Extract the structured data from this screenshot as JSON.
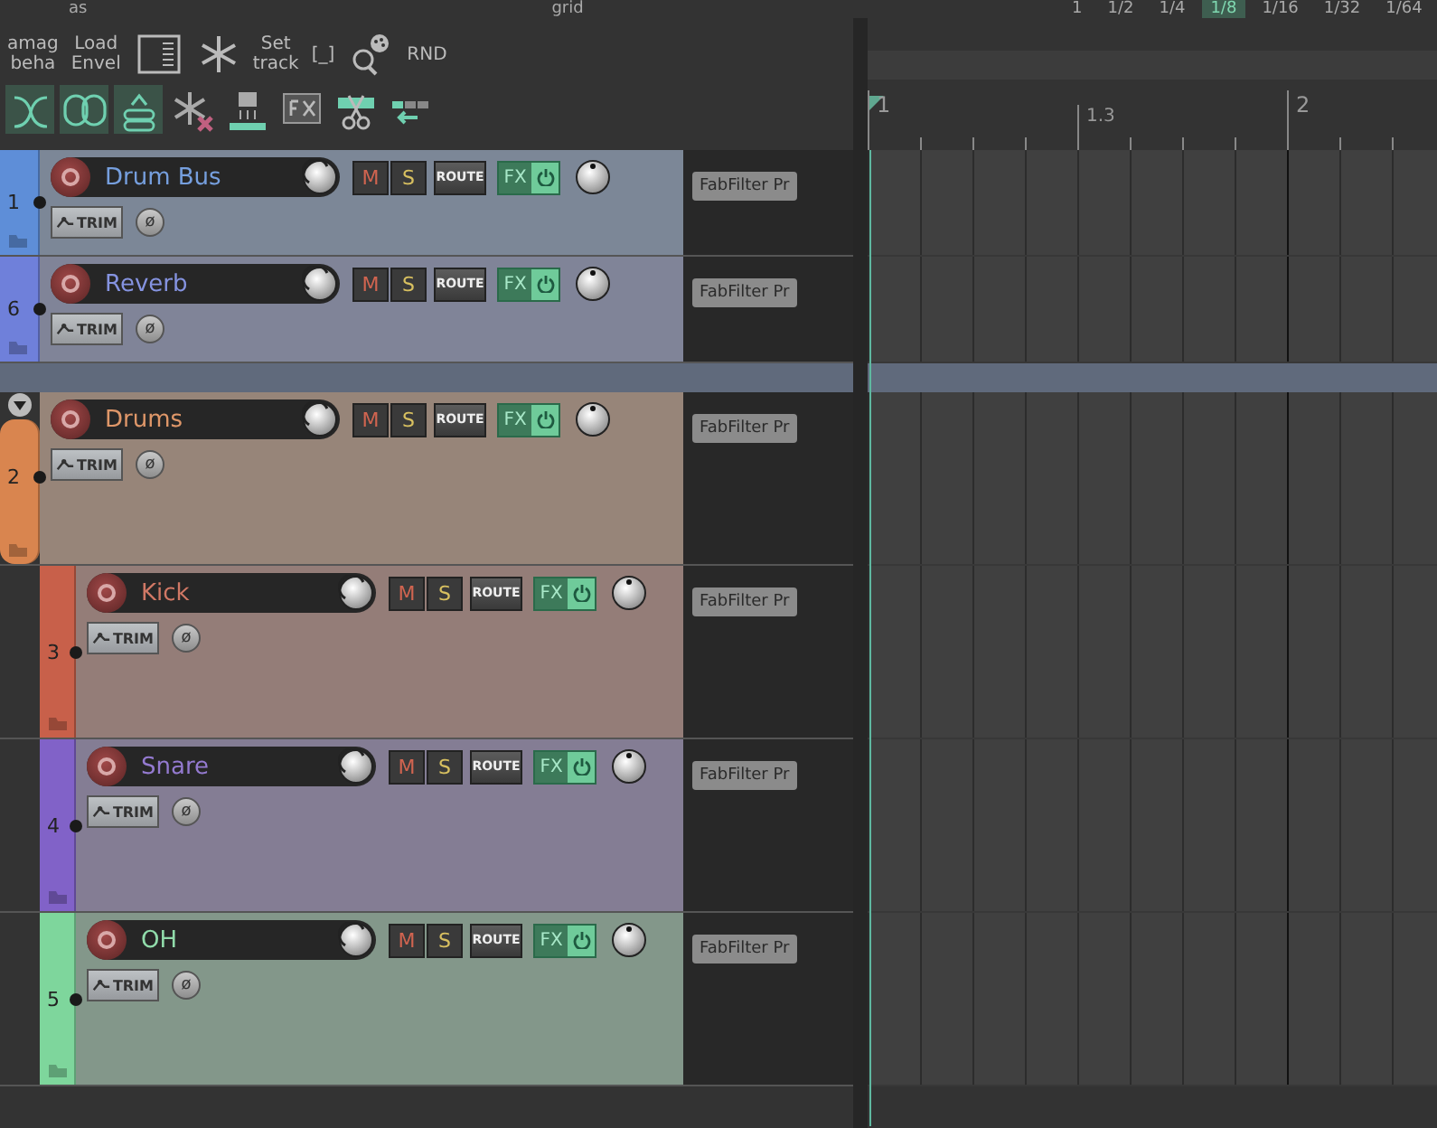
{
  "top_strip": {
    "labels": [
      "as",
      "grid"
    ],
    "divisions": [
      {
        "label": "1",
        "selected": false
      },
      {
        "label": "1/2",
        "selected": false
      },
      {
        "label": "1/4",
        "selected": false
      },
      {
        "label": "1/8",
        "selected": true
      },
      {
        "label": "1/16",
        "selected": false
      },
      {
        "label": "1/32",
        "selected": false
      },
      {
        "label": "1/64",
        "selected": false
      }
    ]
  },
  "toolbar": {
    "row_1": [
      {
        "kind": "text",
        "label": "amag\nbeha"
      },
      {
        "kind": "text",
        "label": "Load\nEnvel"
      },
      {
        "kind": "icon"
      },
      {
        "kind": "icon"
      },
      {
        "kind": "text",
        "label": "Set\ntrack"
      },
      {
        "kind": "text",
        "label": "[_]"
      },
      {
        "kind": "icon"
      },
      {
        "kind": "text",
        "label": "RND"
      }
    ],
    "row_2": [
      {
        "active": true
      },
      {
        "active": true
      },
      {
        "active": true
      },
      {
        "active": false
      },
      {
        "active": false
      },
      {
        "active": false
      },
      {
        "active": false
      },
      {
        "active": false
      }
    ]
  },
  "ruler": {
    "marks": [
      {
        "label": "1",
        "kind": "bar"
      },
      {
        "label": "1.3",
        "kind": "beat"
      },
      {
        "label": "2",
        "kind": "bar"
      }
    ]
  },
  "tracks": [
    {
      "kind": "track",
      "number": "1",
      "name": "Drum Bus",
      "color": "#5e8ed8",
      "mute": "M",
      "solo": "S",
      "route": "ROUTE",
      "fx": "FX",
      "trim": "TRIM",
      "phase": "ø",
      "plugin": "FabFilter Pr"
    },
    {
      "kind": "track",
      "number": "6",
      "name": "Reverb",
      "color": "#6f80da",
      "mute": "M",
      "solo": "S",
      "route": "ROUTE",
      "fx": "FX",
      "trim": "TRIM",
      "phase": "ø",
      "plugin": "FabFilter Pr"
    },
    {
      "kind": "spacer"
    },
    {
      "kind": "folder",
      "expanded": true,
      "number": "2",
      "name": "Drums",
      "color": "#d9854f",
      "mute": "M",
      "solo": "S",
      "route": "ROUTE",
      "fx": "FX",
      "trim": "TRIM",
      "phase": "ø",
      "plugin": "FabFilter Pr",
      "children": [
        {
          "kind": "track",
          "number": "3",
          "name": "Kick",
          "color": "#c8604a",
          "mute": "M",
          "solo": "S",
          "route": "ROUTE",
          "fx": "FX",
          "trim": "TRIM",
          "phase": "ø",
          "plugin": "FabFilter Pr"
        },
        {
          "kind": "track",
          "number": "4",
          "name": "Snare",
          "color": "#8162c8",
          "mute": "M",
          "solo": "S",
          "route": "ROUTE",
          "fx": "FX",
          "trim": "TRIM",
          "phase": "ø",
          "plugin": "FabFilter Pr"
        },
        {
          "kind": "track",
          "number": "5",
          "name": "OH",
          "color": "#7ed69c",
          "mute": "M",
          "solo": "S",
          "route": "ROUTE",
          "fx": "FX",
          "trim": "TRIM",
          "phase": "ø",
          "plugin": "FabFilter Pr"
        }
      ]
    }
  ]
}
